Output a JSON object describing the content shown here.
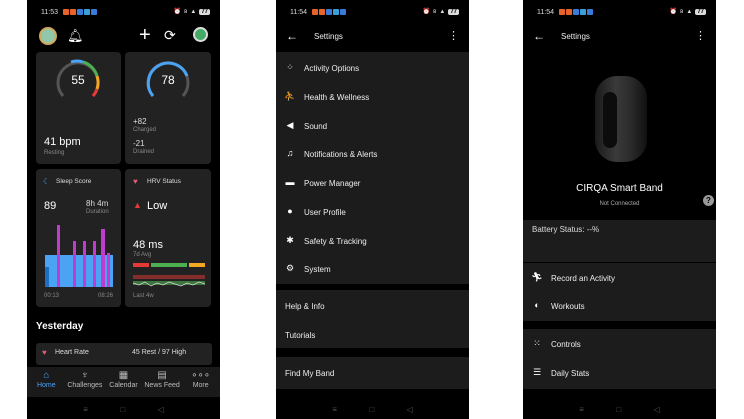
{
  "colors": {
    "accent": "#4ba3f5",
    "resting_ring_green": "#4caf50",
    "resting_ring_red": "#e53935",
    "hrv_low": "#e53935",
    "sleep_bar": "#4ba3f5",
    "sleep_wake": "#c03bd0"
  },
  "status1": {
    "time": "11:53",
    "battery": "77"
  },
  "status2": {
    "time": "11:54",
    "battery": "77"
  },
  "status3": {
    "time": "11:54",
    "battery": "77"
  },
  "home": {
    "heart_gauge": {
      "value": "55"
    },
    "battery_gauge": {
      "value": "78"
    },
    "resting": {
      "value": "41 bpm",
      "label": "Resting"
    },
    "charged": {
      "value": "+82",
      "label": "Charged"
    },
    "drained": {
      "value": "-21",
      "label": "Drained"
    },
    "sleep": {
      "title": "Sleep Score",
      "score": "89",
      "duration": "8h 4m",
      "duration_label": "Duration",
      "start": "00:13",
      "end": "08:26"
    },
    "hrv": {
      "title": "HRV Status",
      "status": "Low",
      "value": "48 ms",
      "value_label": "7d Avg",
      "range_label": "Last 4w"
    },
    "yesterday": "Yesterday",
    "heart_rate_row": {
      "label": "Heart Rate",
      "value": "45 Rest / 97 High"
    },
    "tabs": [
      {
        "label": "Home",
        "icon": "home-icon"
      },
      {
        "label": "Challenges",
        "icon": "laurel-icon"
      },
      {
        "label": "Calendar",
        "icon": "calendar-icon"
      },
      {
        "label": "News Feed",
        "icon": "news-icon"
      },
      {
        "label": "More",
        "icon": "more-icon"
      }
    ]
  },
  "settings": {
    "title": "Settings",
    "items": [
      {
        "label": "Activity Options",
        "icon": "grid-icon"
      },
      {
        "label": "Health & Wellness",
        "icon": "person-icon"
      },
      {
        "label": "Sound",
        "icon": "speaker-icon"
      },
      {
        "label": "Notifications & Alerts",
        "icon": "bell-icon"
      },
      {
        "label": "Power Manager",
        "icon": "truck-icon"
      },
      {
        "label": "User Profile",
        "icon": "user-icon"
      },
      {
        "label": "Safety & Tracking",
        "icon": "safety-icon"
      },
      {
        "label": "System",
        "icon": "gear-icon"
      }
    ],
    "items2": [
      {
        "label": "Help & Info"
      },
      {
        "label": "Tutorials"
      }
    ],
    "items3": [
      {
        "label": "Find My Band"
      }
    ]
  },
  "device": {
    "title": "Settings",
    "name": "CIRQA Smart Band",
    "connection": "Not Connected",
    "battery": "Battery Status: --%",
    "items": [
      {
        "label": "Record an Activity",
        "icon": "run-icon"
      },
      {
        "label": "Workouts",
        "icon": "workout-icon"
      }
    ],
    "items2": [
      {
        "label": "Controls",
        "icon": "dots-circle-icon"
      },
      {
        "label": "Daily Stats",
        "icon": "list-icon"
      }
    ]
  }
}
